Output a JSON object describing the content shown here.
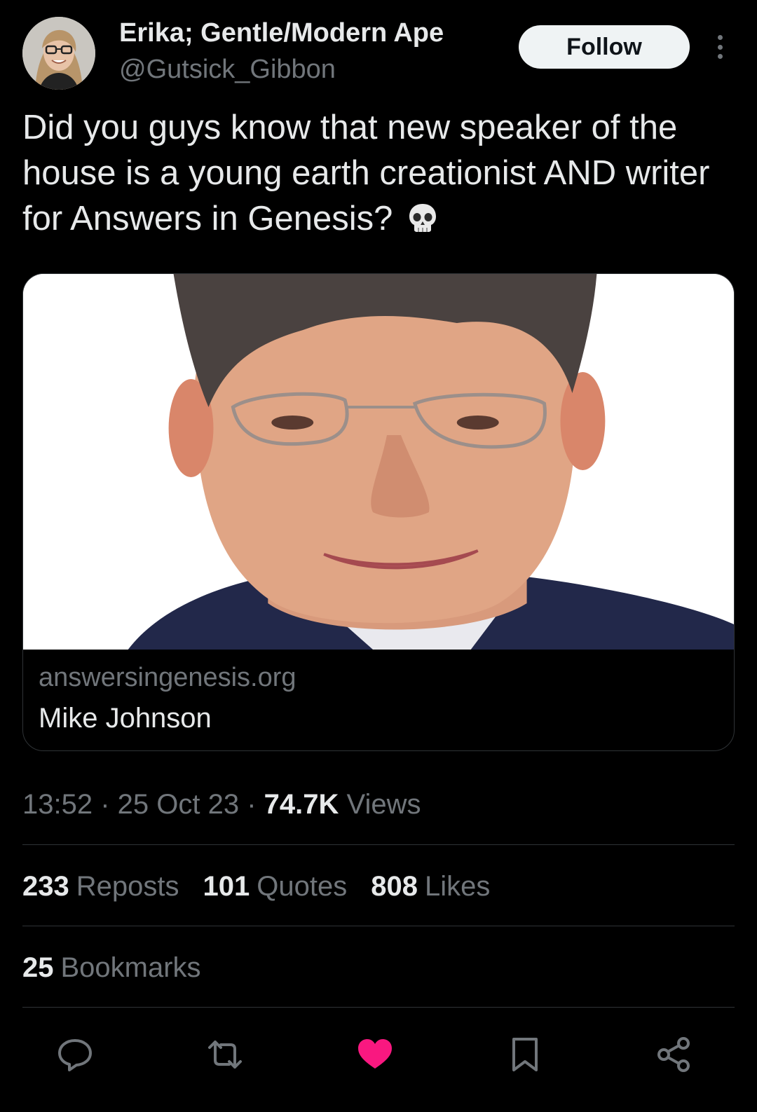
{
  "author": {
    "name": "Erika; Gentle/Modern Ape",
    "handle": "@Gutsick_Gibbon",
    "follow_label": "Follow"
  },
  "tweet": {
    "text": "Did you guys know that new speaker of the house is a young earth creationist AND writer for Answers in Genesis?",
    "emoji_icon": "skull-icon"
  },
  "card": {
    "domain": "answersingenesis.org",
    "title": "Mike Johnson"
  },
  "meta": {
    "time": "13:52",
    "sep1": " · ",
    "date": "25 Oct 23",
    "sep2": " · ",
    "views_count": "74.7K",
    "views_label": " Views"
  },
  "stats": {
    "reposts_count": "233",
    "reposts_label": "Reposts",
    "quotes_count": "101",
    "quotes_label": "Quotes",
    "likes_count": "808",
    "likes_label": "Likes",
    "bookmarks_count": "25",
    "bookmarks_label": "Bookmarks"
  },
  "actions": {
    "icons": [
      "reply-icon",
      "repost-icon",
      "like-icon",
      "bookmark-icon",
      "share-icon"
    ],
    "like_color": "#f91880",
    "icon_color": "#71767b"
  },
  "colors": {
    "background": "#000000",
    "text_primary": "#e7e9ea",
    "text_secondary": "#71767b",
    "divider": "#2f3336"
  }
}
